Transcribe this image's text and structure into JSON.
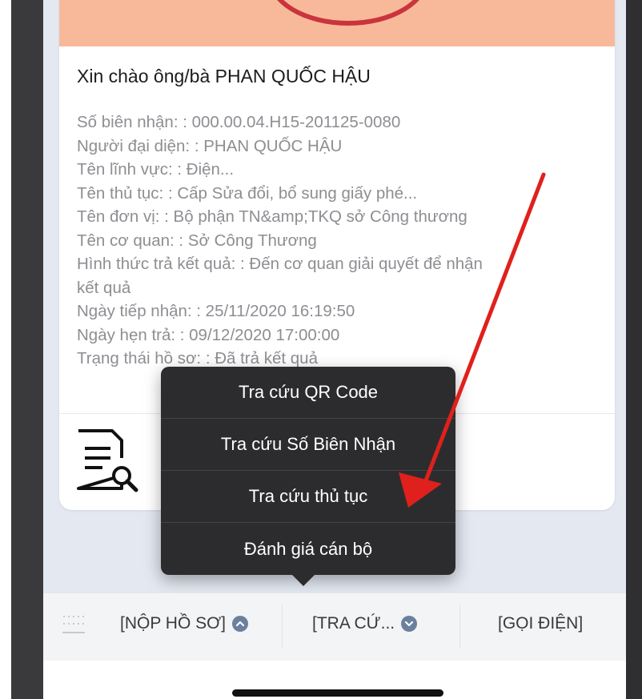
{
  "card": {
    "greeting": "Xin chào ông/bà PHAN QUỐC HẬU",
    "details": [
      "Số biên nhận: : 000.00.04.H15-201125-0080",
      "Người đại diện: : PHAN QUỐC HẬU",
      "Tên lĩnh vực: : Điện...",
      "Tên thủ tục: : Cấp Sửa đổi, bổ sung giấy phé...",
      "Tên đơn vị: : Bộ phận TN&amp;TKQ sở Công thương",
      "Tên cơ quan: : Sở Công Thương",
      "Hình thức trả kết quả: : Đến cơ quan giải quyết để nhận",
      "kết quả",
      "Ngày tiếp nhận: : 25/11/2020 16:19:50",
      "Ngày hẹn trả: : 09/12/2020 17:00:00",
      "Trạng thái hồ sơ: : Đã trả kết quả"
    ]
  },
  "popup_menu": {
    "items": [
      "Tra cứu QR Code",
      "Tra cứu Số Biên Nhận",
      "Tra cứu thủ tục",
      "Đánh giá cán bộ"
    ]
  },
  "bottom_bar": {
    "submit_label": "[NỘP HỒ SƠ]",
    "lookup_label": "[TRA CỨ...",
    "call_label": "[GỌI ĐIỆN]"
  },
  "colors": {
    "banner": "#f8b99a",
    "popup_bg": "#2c2c2e",
    "annotation_arrow": "#e0201c",
    "nav_circle": "#6b7f9e"
  },
  "icons": {
    "document": "document-search-icon",
    "submit": "chevron-up-circle-icon",
    "lookup": "chevron-down-circle-icon",
    "grip": "grip-dots-icon"
  }
}
